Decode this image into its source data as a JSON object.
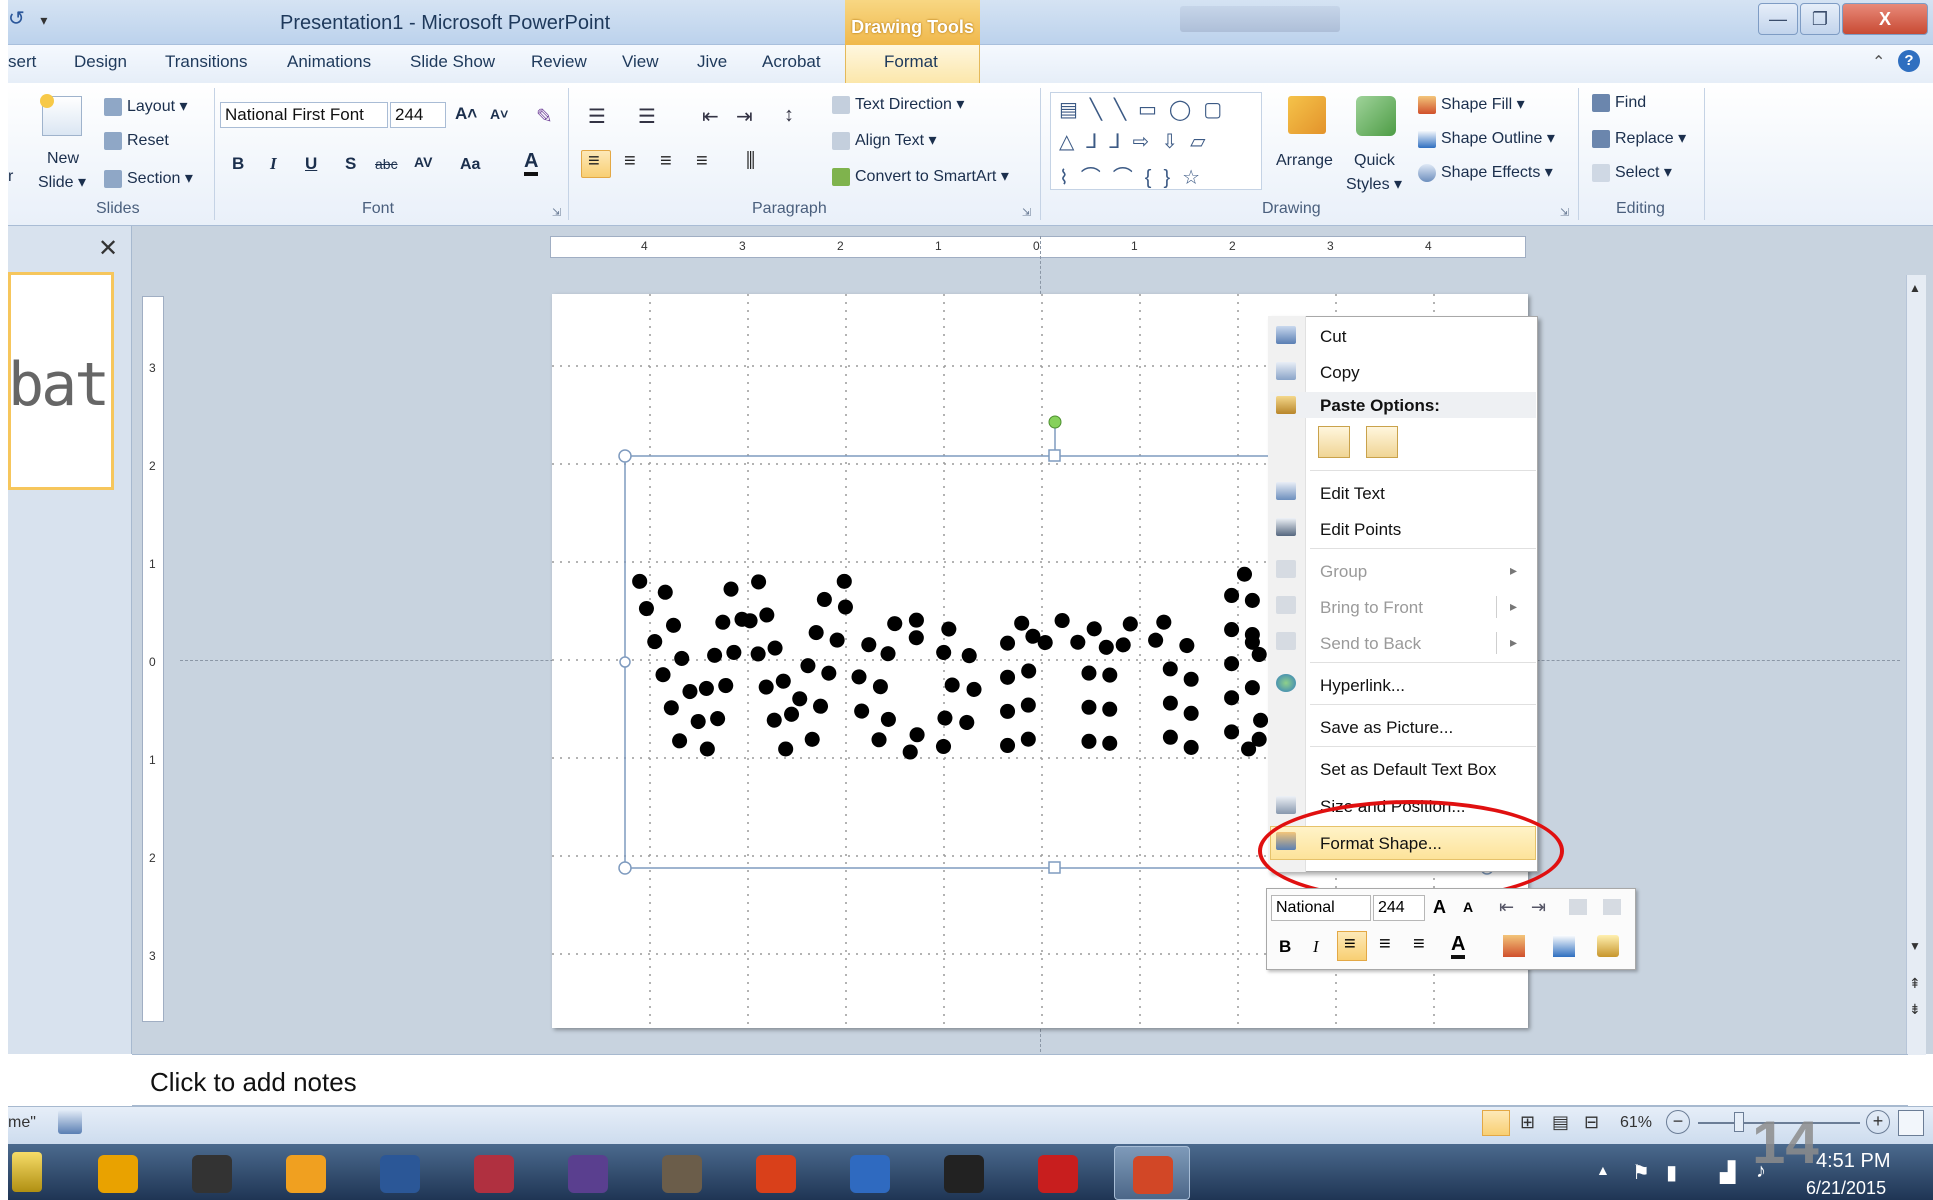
{
  "window": {
    "title": "Presentation1 - Microsoft PowerPoint",
    "context_tab_group": "Drawing Tools",
    "minimize": "—",
    "restore": "❐",
    "close": "X"
  },
  "tabs": [
    "sert",
    "Design",
    "Transitions",
    "Animations",
    "Slide Show",
    "Review",
    "View",
    "Jive",
    "Acrobat",
    "Format"
  ],
  "ribbon": {
    "slides": {
      "label": "Slides",
      "new_slide": "New",
      "new_slide2": "Slide ▾",
      "layout": "Layout ▾",
      "reset": "Reset",
      "section": "Section ▾",
      "left_edge": "r"
    },
    "font": {
      "label": "Font",
      "font_name": "National First Font",
      "font_size": "244",
      "bold": "B",
      "italic": "I",
      "underline": "U",
      "shadow": "S",
      "strike": "abc",
      "spacing": "AV",
      "case": "Aa",
      "grow": "A˄",
      "shrink": "A˅",
      "color": "A"
    },
    "paragraph": {
      "label": "Paragraph",
      "text_direction": "Text Direction ▾",
      "align_text": "Align Text ▾",
      "convert_smartart": "Convert to SmartArt ▾"
    },
    "drawing": {
      "label": "Drawing",
      "arrange": "Arrange",
      "quick_styles": "Quick",
      "quick_styles2": "Styles ▾",
      "shape_fill": "Shape Fill ▾",
      "shape_outline": "Shape Outline ▾",
      "shape_effects": "Shape Effects ▾"
    },
    "editing": {
      "label": "Editing",
      "find": "Find",
      "replace": "Replace ▾",
      "select": "Select ▾"
    }
  },
  "left_pane": {
    "close": "✕",
    "thumb_text": "bat"
  },
  "hruler_ticks": [
    "4",
    "3",
    "2",
    "1",
    "0",
    "1",
    "2",
    "3",
    "4"
  ],
  "vruler_ticks": [
    "3",
    "2",
    "1",
    "0",
    "1",
    "2",
    "3"
  ],
  "slide": {
    "text": "Wombat"
  },
  "context_menu": {
    "cut": "Cut",
    "copy": "Copy",
    "paste_options": "Paste Options:",
    "edit_text": "Edit Text",
    "edit_points": "Edit Points",
    "group": "Group",
    "bring_to_front": "Bring to Front",
    "send_to_back": "Send to Back",
    "hyperlink": "Hyperlink...",
    "save_as_picture": "Save as Picture...",
    "set_default_text_box": "Set as Default Text Box",
    "size_and_position": "Size and Position...",
    "format_shape": "Format Shape...",
    "submenu_arrow": "▸"
  },
  "mini_toolbar": {
    "font": "National",
    "size": "244",
    "bold": "B",
    "italic": "I"
  },
  "notes": {
    "placeholder": "Click to add notes"
  },
  "status": {
    "left_text": "me\"",
    "zoom": "61%",
    "zoom_out": "−",
    "zoom_in": "+"
  },
  "taskbar": {
    "apps": [
      {
        "name": "chrome",
        "color": "#e9a200",
        "active": false
      },
      {
        "name": "inkscape",
        "color": "#333333",
        "active": false
      },
      {
        "name": "outlook",
        "color": "#f0a020",
        "active": false
      },
      {
        "name": "word",
        "color": "#2b5797",
        "active": false
      },
      {
        "name": "access",
        "color": "#b03040",
        "active": false
      },
      {
        "name": "eclipse",
        "color": "#5a3f8f",
        "active": false
      },
      {
        "name": "gimp",
        "color": "#6b5d4a",
        "active": false
      },
      {
        "name": "firefox-devedition",
        "color": "#d9401a",
        "active": false
      },
      {
        "name": "thunderbird",
        "color": "#2f6ac0",
        "active": false
      },
      {
        "name": "kindle",
        "color": "#222222",
        "active": false
      },
      {
        "name": "acrobat",
        "color": "#c81e1e",
        "active": false
      },
      {
        "name": "powerpoint",
        "color": "#d24726",
        "active": true
      }
    ],
    "time": "4:51 PM",
    "date": "6/21/2015"
  },
  "watermark": "14",
  "colors": {
    "accent": "#2b579a",
    "context_tab": "#f0b84b",
    "highlight": "#fde39a",
    "annotation": "#e01010"
  }
}
